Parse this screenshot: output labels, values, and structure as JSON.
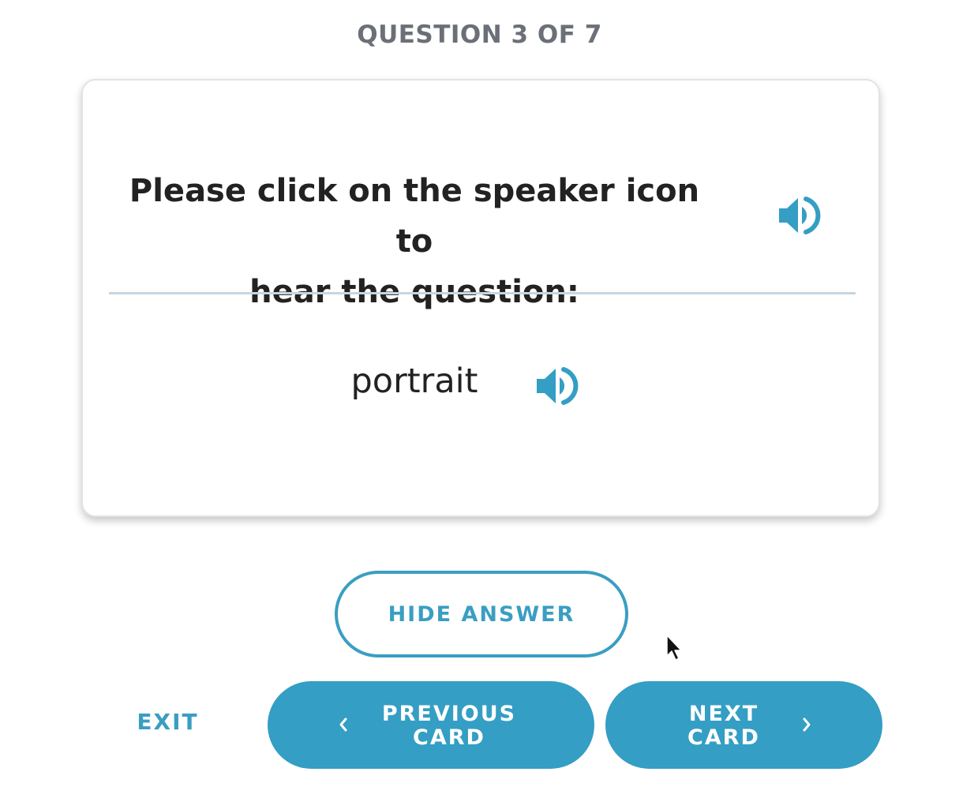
{
  "header": {
    "progress_text": "QUESTION 3 OF 7"
  },
  "card": {
    "question_line1": "Please click on the speaker icon to",
    "question_line2": "hear the question:",
    "answer": "portrait",
    "speaker_icon": "speaker-volume-icon"
  },
  "actions": {
    "hide_answer_label": "HIDE ANSWER",
    "exit_label": "EXIT",
    "previous_line1": "PREVIOUS",
    "previous_line2": "CARD",
    "next_line1": "NEXT",
    "next_line2": "CARD"
  },
  "colors": {
    "accent": "#349ec4",
    "text": "#222222",
    "muted": "#6b7078",
    "divider": "#c6d6df"
  }
}
